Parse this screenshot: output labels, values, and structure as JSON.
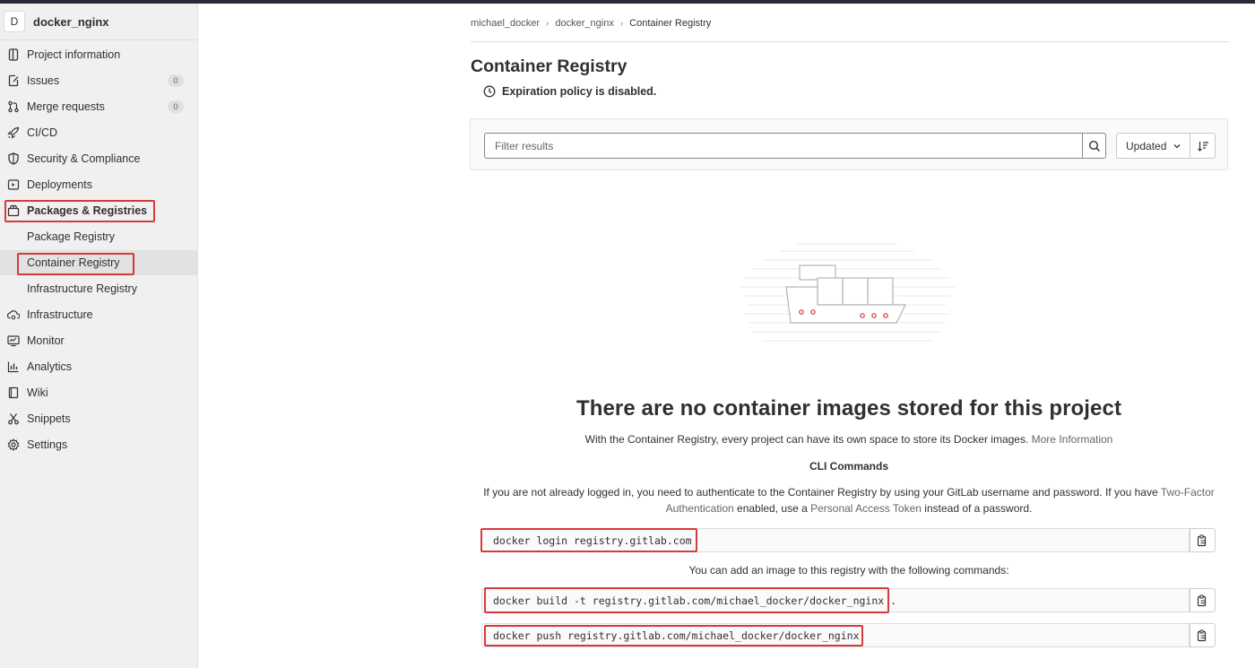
{
  "project": {
    "avatar_letter": "D",
    "name": "docker_nginx"
  },
  "sidebar": {
    "items": [
      {
        "label": "Project information",
        "icon": "project-icon"
      },
      {
        "label": "Issues",
        "icon": "issues-icon",
        "count": "0"
      },
      {
        "label": "Merge requests",
        "icon": "merge-request-icon",
        "count": "0"
      },
      {
        "label": "CI/CD",
        "icon": "rocket-icon"
      },
      {
        "label": "Security & Compliance",
        "icon": "shield-icon"
      },
      {
        "label": "Deployments",
        "icon": "deployments-icon"
      },
      {
        "label": "Packages & Registries",
        "icon": "package-icon"
      },
      {
        "label": "Package Registry"
      },
      {
        "label": "Container Registry"
      },
      {
        "label": "Infrastructure Registry"
      },
      {
        "label": "Infrastructure",
        "icon": "cloud-gear-icon"
      },
      {
        "label": "Monitor",
        "icon": "monitor-icon"
      },
      {
        "label": "Analytics",
        "icon": "chart-icon"
      },
      {
        "label": "Wiki",
        "icon": "book-icon"
      },
      {
        "label": "Snippets",
        "icon": "scissors-icon"
      },
      {
        "label": "Settings",
        "icon": "gear-icon"
      }
    ]
  },
  "breadcrumb": [
    "michael_docker",
    "docker_nginx",
    "Container Registry"
  ],
  "page": {
    "title": "Container Registry",
    "policy_text": "Expiration policy is disabled."
  },
  "filter": {
    "placeholder": "Filter results",
    "sort_label": "Updated"
  },
  "empty_state": {
    "title": "There are no container images stored for this project",
    "desc": "With the Container Registry, every project can have its own space to store its Docker images.",
    "more_info": "More Information",
    "cli_title": "CLI Commands",
    "note_a": "If you are not already logged in, you need to authenticate to the Container Registry by using your GitLab username and password. If you have",
    "note_link1": "Two-Factor Authentication",
    "note_b": "enabled, use a",
    "note_link2": "Personal Access Token",
    "note_c": "instead of a password.",
    "add_note": "You can add an image to this registry with the following commands:",
    "commands": [
      "docker login registry.gitlab.com",
      "docker build -t registry.gitlab.com/michael_docker/docker_nginx .",
      "docker push registry.gitlab.com/michael_docker/docker_nginx"
    ]
  },
  "colors": {
    "highlight_border": "#d63a3a",
    "sidebar_bg": "#f0f0f0",
    "topbar": "#2b2838"
  }
}
